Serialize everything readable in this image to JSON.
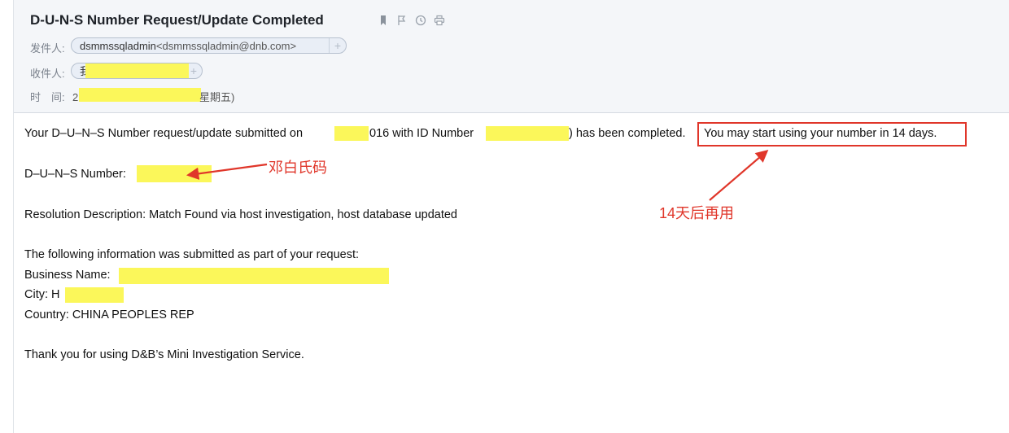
{
  "email": {
    "subject": "D-U-N-S Number Request/Update Completed",
    "from_label": "发件人:",
    "from_name": "dsmmssqladmin",
    "from_email": "<dsmmssqladmin@dnb.com>",
    "to_label": "收件人:",
    "to_value": "我<",
    "time_label": "时　间:",
    "time_prefix": "2",
    "time_suffix": "星期五)"
  },
  "icons": [
    "bookmark-icon",
    "flag-icon",
    "clock-icon",
    "print-icon"
  ],
  "body": {
    "line1_a": "Your D–U–N–S Number request/update submitted on",
    "line1_b": "016 with ID Number",
    "line1_c": ") has been completed.",
    "line1_boxed": "You may start using your number in 14 days.",
    "duns_label": "D–U–N–S Number:",
    "resolution": "Resolution Description: Match Found via host investigation, host database updated",
    "submitted_intro": "The following information was submitted as part of your request:",
    "business_name_label": "Business Name:",
    "city_label": "City: H",
    "country": "Country: CHINA PEOPLES REP",
    "thanks": "Thank you for using D&B’s Mini Investigation Service."
  },
  "annotations": {
    "duns_note": "邓白氏码",
    "days_note": "14天后再用",
    "accent_color": "#e0362a",
    "highlight_color": "#fbf75a"
  }
}
